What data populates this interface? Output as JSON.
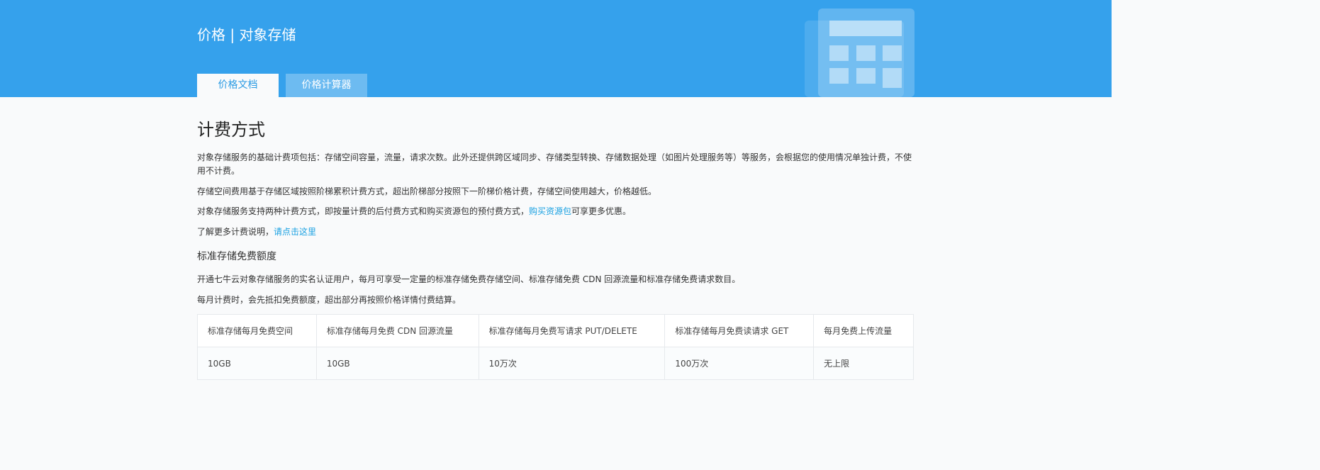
{
  "header": {
    "title": "价格 | 对象存储",
    "tabs": [
      {
        "label": "价格文档",
        "active": true
      },
      {
        "label": "价格计算器",
        "active": false
      }
    ]
  },
  "main": {
    "heading": "计费方式",
    "para1": "对象存储服务的基础计费项包括：存储空间容量，流量，请求次数。此外还提供跨区域同步、存储类型转换、存储数据处理（如图片处理服务等）等服务，会根据您的使用情况单独计费，不使用不计费。",
    "para2": "存储空间费用基于存储区域按照阶梯累积计费方式，超出阶梯部分按照下一阶梯价格计费，存储空间使用越大，价格越低。",
    "para3_before": "对象存储服务支持两种计费方式，即按量计费的后付费方式和购买资源包的预付费方式，",
    "para3_link": "购买资源包",
    "para3_after": "可享更多优惠。",
    "para4_before": "了解更多计费说明，",
    "para4_link": "请点击这里",
    "subheading": "标准存储免费额度",
    "para5": "开通七牛云对象存储服务的实名认证用户，每月可享受一定量的标准存储免费存储空间、标准存储免费 CDN 回源流量和标准存储免费请求数目。",
    "para6": "每月计费时，会先抵扣免费额度，超出部分再按照价格详情付费结算。",
    "table": {
      "headers": [
        "标准存储每月免费空间",
        "标准存储每月免费 CDN 回源流量",
        "标准存储每月免费写请求 PUT/DELETE",
        "标准存储每月免费读请求 GET",
        "每月免费上传流量"
      ],
      "rows": [
        [
          "10GB",
          "10GB",
          "10万次",
          "100万次",
          "无上限"
        ]
      ]
    }
  },
  "colors": {
    "hero_bg": "#35a1ec",
    "link": "#1aa1e2",
    "page_bg": "#f9fafb"
  }
}
